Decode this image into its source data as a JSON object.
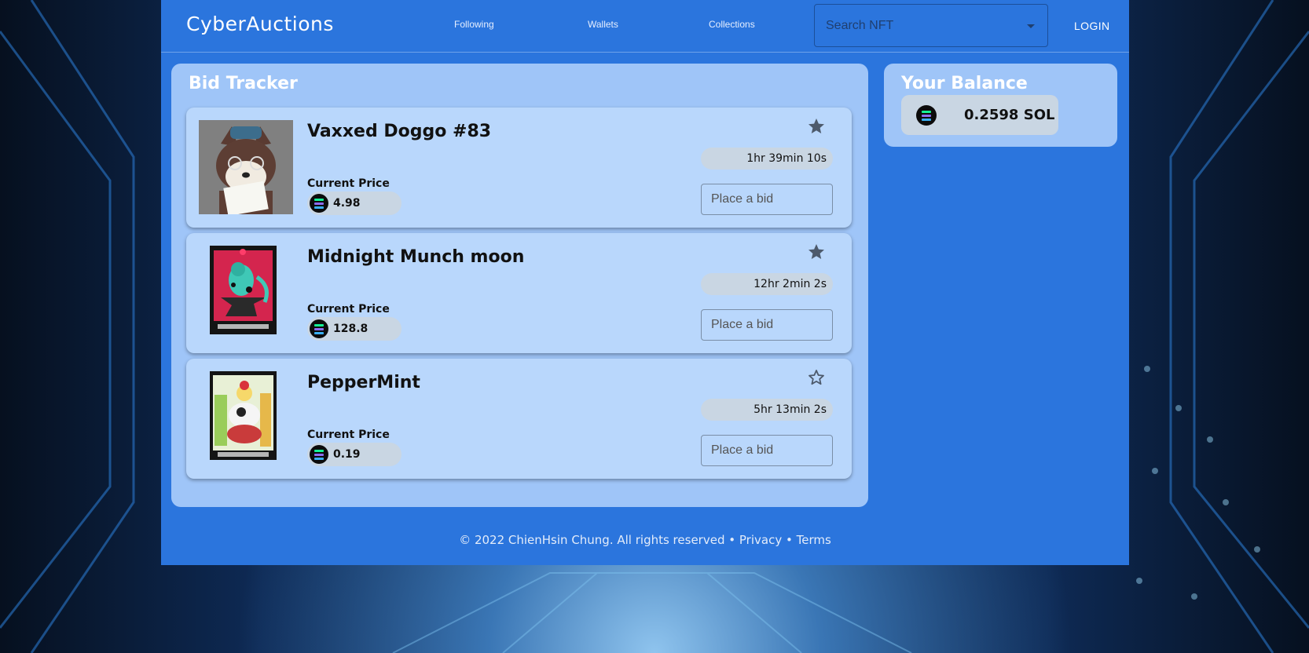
{
  "app": {
    "logo": "CyberAuctions",
    "nav": [
      "Following",
      "Wallets",
      "Collections"
    ],
    "search_placeholder": "Search NFT",
    "login_label": "LOGIN"
  },
  "tracker": {
    "title": "Bid Tracker",
    "price_label": "Current Price",
    "bid_placeholder": "Place a bid",
    "items": [
      {
        "name": "Vaxxed Doggo #83",
        "price": "4.98",
        "timer": "1hr 39min 10s",
        "starred": true
      },
      {
        "name": "Midnight Munch moon",
        "price": "128.8",
        "timer": "12hr 2min 2s",
        "starred": true
      },
      {
        "name": "PepperMint",
        "price": "0.19",
        "timer": "5hr 13min 2s",
        "starred": false
      }
    ]
  },
  "balance": {
    "title": "Your Balance",
    "value": "0.2598 SOL"
  },
  "footer": {
    "copyright": "© 2022 ChienHsin Chung. All rights reserved",
    "sep": "•",
    "privacy": "Privacy",
    "terms": "Terms"
  },
  "colors": {
    "primary": "#2b75dd",
    "panel": "#9fc5f8",
    "card": "#b9d7fc",
    "pill": "#c9d6e3"
  },
  "icons": {
    "star_filled": "star-filled-icon",
    "star_outline": "star-outline-icon",
    "currency": "solana-icon"
  }
}
